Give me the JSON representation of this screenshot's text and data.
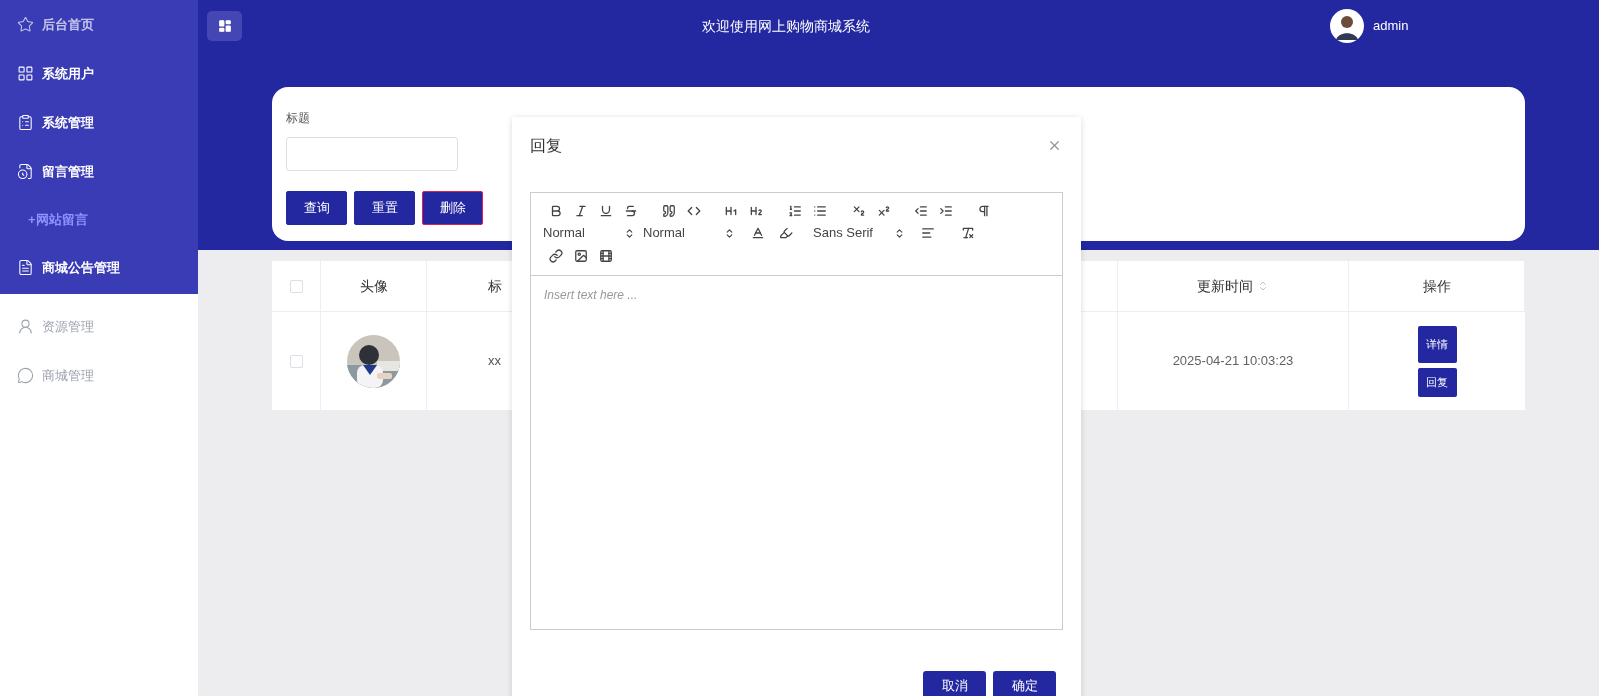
{
  "sidebar": {
    "items": [
      {
        "label": "后台首页",
        "kind": "section"
      },
      {
        "label": "系统用户",
        "kind": "section"
      },
      {
        "label": "系统管理",
        "kind": "section"
      },
      {
        "label": "留言管理",
        "kind": "section"
      },
      {
        "label": "+网站留言",
        "kind": "sub"
      },
      {
        "label": "商城公告管理",
        "kind": "section"
      },
      {
        "label": "资源管理",
        "kind": "plain"
      },
      {
        "label": "商城管理",
        "kind": "plain"
      }
    ]
  },
  "header": {
    "title": "欢迎使用网上购物商城系统",
    "user": "admin"
  },
  "search": {
    "fields": [
      {
        "label": "标题"
      }
    ],
    "buttons": [
      {
        "label": "查询",
        "kind": "primary"
      },
      {
        "label": "重置",
        "kind": "primary"
      },
      {
        "label": "删除",
        "kind": "danger"
      }
    ]
  },
  "table": {
    "columns": [
      {
        "kind": "checkbox",
        "checked": false
      },
      {
        "kind": "text",
        "label": "头像"
      },
      {
        "kind": "text",
        "label": "标"
      },
      {
        "kind": "sort",
        "label": "更新时间"
      },
      {
        "kind": "text",
        "label": "操作"
      }
    ],
    "rows": [
      {
        "checked": false,
        "avatar": {
          "kind": "picture"
        },
        "title": "xx",
        "updated": "2025-04-21 10:03:23",
        "actions": [
          "详情",
          "回复"
        ]
      }
    ]
  },
  "dialog": {
    "title": "回复",
    "selects": [
      "Normal",
      "Normal",
      "Sans Serif"
    ],
    "placeholder": "Insert text here ...",
    "buttons": [
      "取消",
      "确定"
    ]
  }
}
